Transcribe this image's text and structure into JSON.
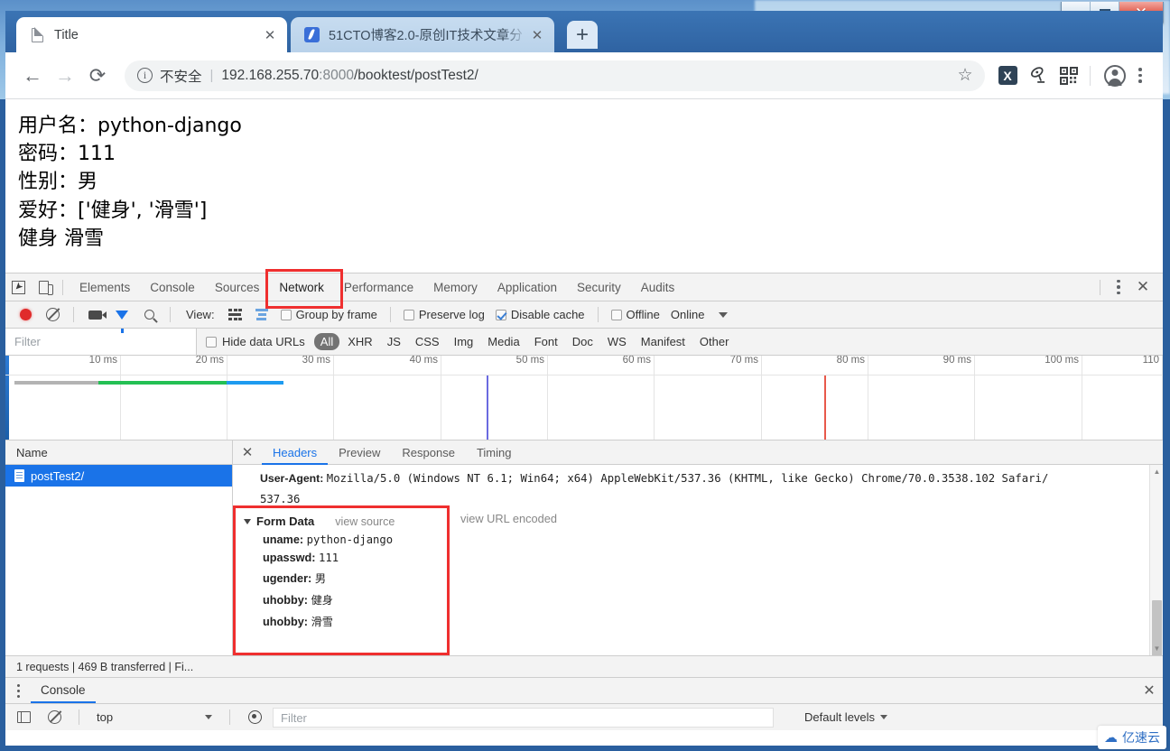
{
  "window": {
    "minimize_label": "Minimize",
    "maximize_label": "Maximize",
    "close_label": "✕"
  },
  "browser": {
    "tabs": [
      {
        "title": "Title",
        "favicon": "document-icon",
        "active": true,
        "close_label": "✕"
      },
      {
        "title": "51CTO博客2.0-原创IT技术文章分",
        "favicon": "51cto-icon",
        "active": false,
        "close_label": "✕"
      }
    ],
    "new_tab_label": "+",
    "nav": {
      "back_label": "←",
      "forward_label": "→",
      "reload_label": "⟳"
    },
    "omnibox": {
      "info_icon_label": "ⓘ",
      "security_text": "不安全",
      "separator": "|",
      "url_host": "192.168.255.70",
      "url_port": ":8000",
      "url_path": "/booktest/postTest2/",
      "star_label": "☆"
    },
    "toolbar_icons": {
      "extension_x": "X",
      "satellite": "satellite-icon",
      "qrcode": "qr-code-icon",
      "profile": "profile-avatar",
      "menu": "three-dot-menu"
    }
  },
  "page_content": {
    "lines": [
      "用户名：python-django",
      "密码：111",
      "性别：男",
      "爱好：['健身', '滑雪']",
      "健身 滑雪"
    ]
  },
  "devtools": {
    "panel_tabs": [
      {
        "label": "Elements",
        "active": false
      },
      {
        "label": "Console",
        "active": false
      },
      {
        "label": "Sources",
        "active": false
      },
      {
        "label": "Network",
        "active": true,
        "highlighted": true
      },
      {
        "label": "Performance",
        "active": false
      },
      {
        "label": "Memory",
        "active": false
      },
      {
        "label": "Application",
        "active": false
      },
      {
        "label": "Security",
        "active": false
      },
      {
        "label": "Audits",
        "active": false
      }
    ],
    "panel_close_label": "✕",
    "network_toolbar": {
      "view_label": "View:",
      "group_by_frame": {
        "label": "Group by frame",
        "checked": false
      },
      "preserve_log": {
        "label": "Preserve log",
        "checked": false
      },
      "disable_cache": {
        "label": "Disable cache",
        "checked": true
      },
      "offline": {
        "label": "Offline",
        "checked": false
      },
      "throttling": "Online"
    },
    "filter_bar": {
      "filter_placeholder": "Filter",
      "hide_data_urls": {
        "label": "Hide data URLs",
        "checked": false
      },
      "types": [
        {
          "label": "All",
          "selected": true
        },
        {
          "label": "XHR",
          "selected": false
        },
        {
          "label": "JS",
          "selected": false
        },
        {
          "label": "CSS",
          "selected": false
        },
        {
          "label": "Img",
          "selected": false
        },
        {
          "label": "Media",
          "selected": false
        },
        {
          "label": "Font",
          "selected": false
        },
        {
          "label": "Doc",
          "selected": false
        },
        {
          "label": "WS",
          "selected": false
        },
        {
          "label": "Manifest",
          "selected": false
        },
        {
          "label": "Other",
          "selected": false
        }
      ]
    },
    "timeline": {
      "ticks": [
        "10 ms",
        "20 ms",
        "30 ms",
        "40 ms",
        "50 ms",
        "60 ms",
        "70 ms",
        "80 ms",
        "90 ms",
        "100 ms",
        "110"
      ],
      "request_bar": {
        "queue_color": "#b3b3b3",
        "wait_color": "#24c054",
        "download_color": "#1e9bf0"
      },
      "dom_content_loaded_color": "#6a6ae0",
      "load_event_color": "#e8594b"
    },
    "requests": {
      "name_header": "Name",
      "rows": [
        {
          "name": "postTest2/",
          "selected": true,
          "icon": "document-icon"
        }
      ]
    },
    "detail": {
      "close_label": "✕",
      "tabs": [
        {
          "label": "Headers",
          "active": true
        },
        {
          "label": "Preview",
          "active": false
        },
        {
          "label": "Response",
          "active": false
        },
        {
          "label": "Timing",
          "active": false
        }
      ],
      "user_agent": {
        "key": "User-Agent:",
        "value": "Mozilla/5.0 (Windows NT 6.1; Win64; x64) AppleWebKit/537.36 (KHTML, like Gecko) Chrome/70.0.3538.102 Safari/",
        "value_wrap": "537.36"
      },
      "form_data": {
        "title": "Form Data",
        "view_source": "view source",
        "view_url_encoded": "view URL encoded",
        "highlight_color": "#ef2f2f",
        "rows": [
          {
            "key": "uname:",
            "value": "python-django"
          },
          {
            "key": "upasswd:",
            "value": "111"
          },
          {
            "key": "ugender:",
            "value": "男"
          },
          {
            "key": "uhobby:",
            "value": "健身"
          },
          {
            "key": "uhobby:",
            "value": "滑雪"
          }
        ]
      }
    },
    "status_bar": "1 requests  |  469 B transferred  |  Fi..."
  },
  "console_drawer": {
    "tab_label": "Console",
    "close_label": "✕",
    "context": "top",
    "filter_placeholder": "Filter",
    "levels_label": "Default levels"
  },
  "watermark": {
    "icon": "cloud-icon",
    "text": "亿速云"
  }
}
